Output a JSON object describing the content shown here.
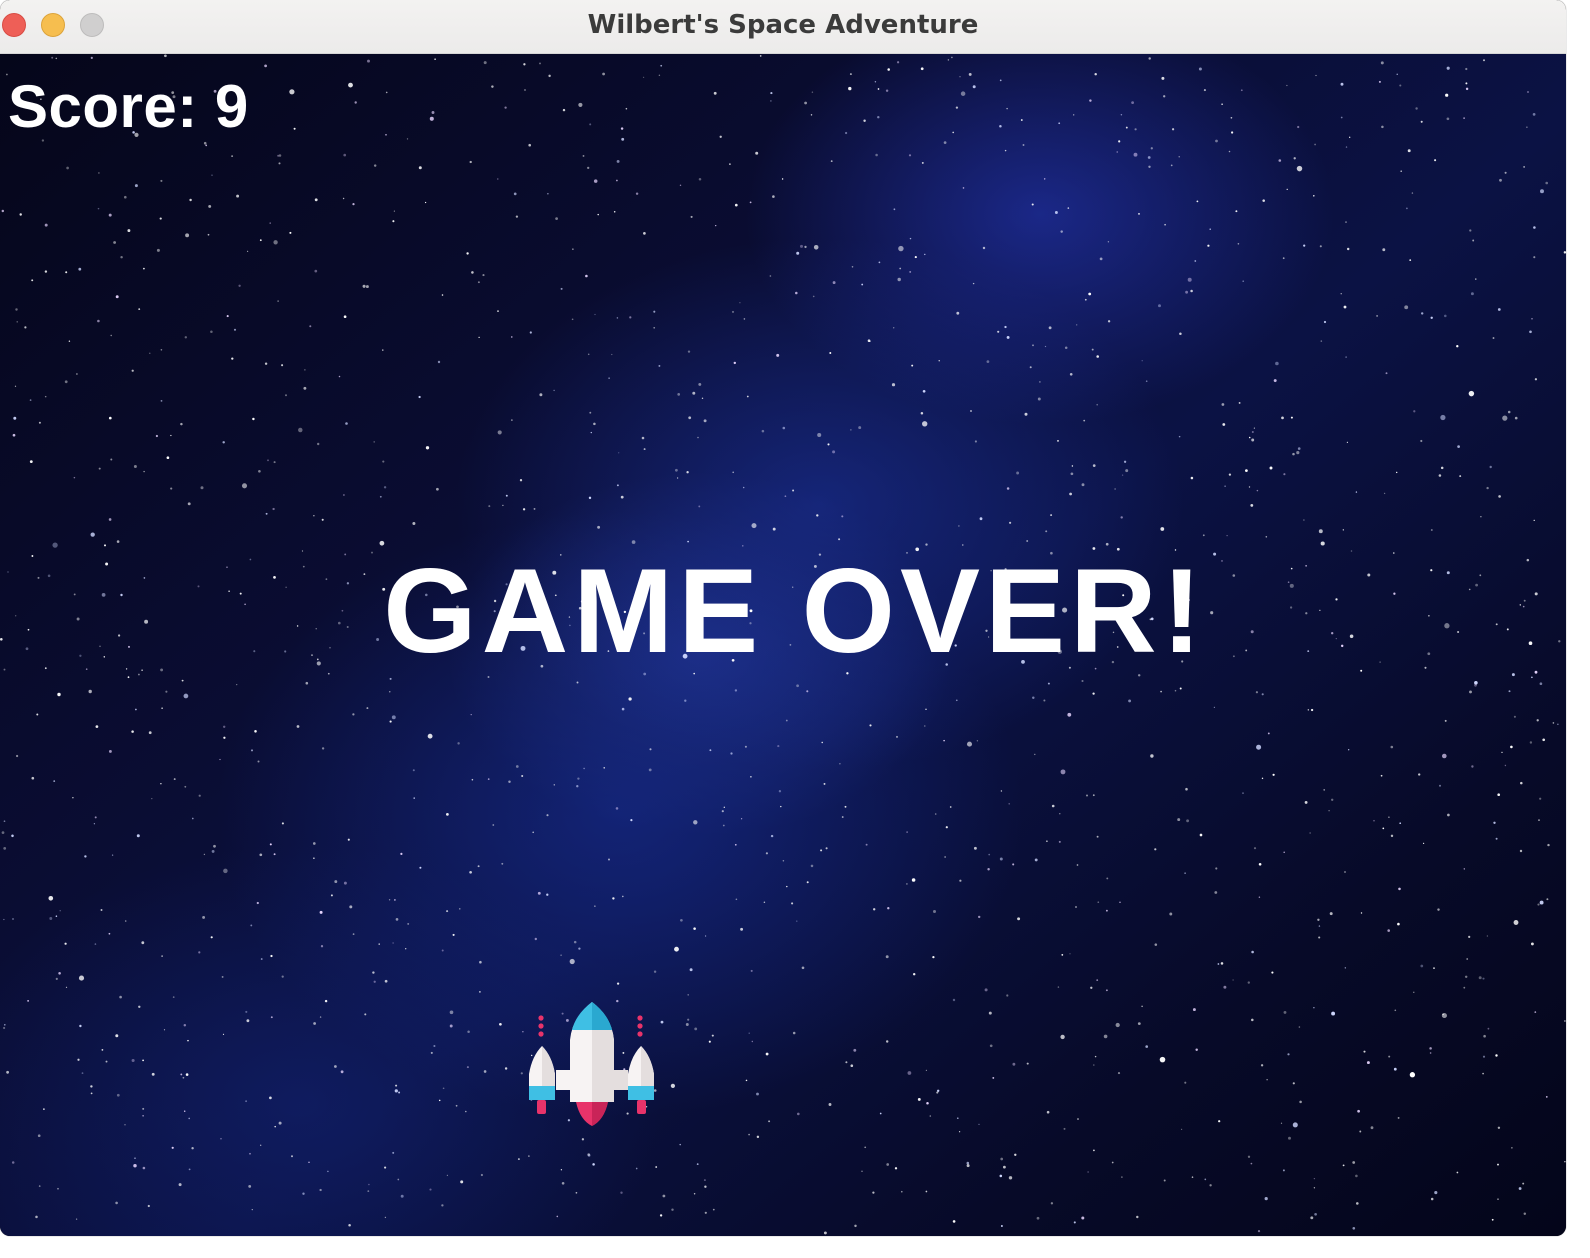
{
  "window": {
    "title": "Wilbert's Space Adventure",
    "controls": [
      "close",
      "minimize",
      "maximize"
    ]
  },
  "game": {
    "score_text": "Score: 9",
    "message": "GAME OVER!",
    "player_icon": "spaceship-icon",
    "colors": {
      "background": "#070a28",
      "text": "#ffffff",
      "ship_body": "#f7f3f3",
      "ship_accent_cyan": "#3fbfe4",
      "ship_accent_red": "#e8336a"
    }
  }
}
